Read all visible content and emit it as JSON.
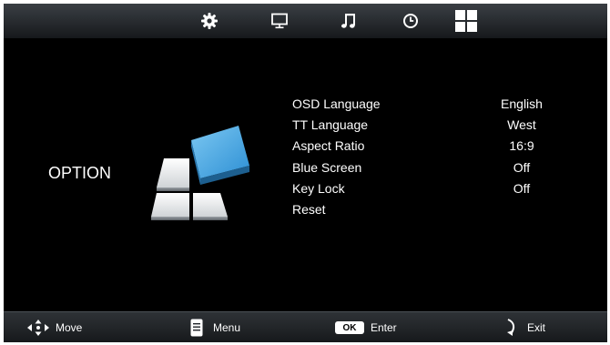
{
  "colors": {
    "background": "#000000",
    "text": "#ffffff",
    "accent_tile": "#3fa2e0"
  },
  "tabs": [
    {
      "icon": "gear-icon",
      "selected": false
    },
    {
      "icon": "monitor-icon",
      "selected": false
    },
    {
      "icon": "music-note-icon",
      "selected": false
    },
    {
      "icon": "clock-icon",
      "selected": false
    },
    {
      "icon": "option-grid-icon",
      "selected": true
    }
  ],
  "section": {
    "title": "OPTION",
    "icon": "option-tiles-icon"
  },
  "menu": {
    "items": [
      {
        "label": "OSD Language",
        "value": "English"
      },
      {
        "label": "TT Language",
        "value": "West"
      },
      {
        "label": "Aspect Ratio",
        "value": "16:9"
      },
      {
        "label": "Blue Screen",
        "value": "Off"
      },
      {
        "label": "Key Lock",
        "value": "Off"
      },
      {
        "label": "Reset",
        "value": ""
      }
    ]
  },
  "help": {
    "move": "Move",
    "menu": "Menu",
    "ok_key": "OK",
    "enter": "Enter",
    "exit": "Exit"
  }
}
